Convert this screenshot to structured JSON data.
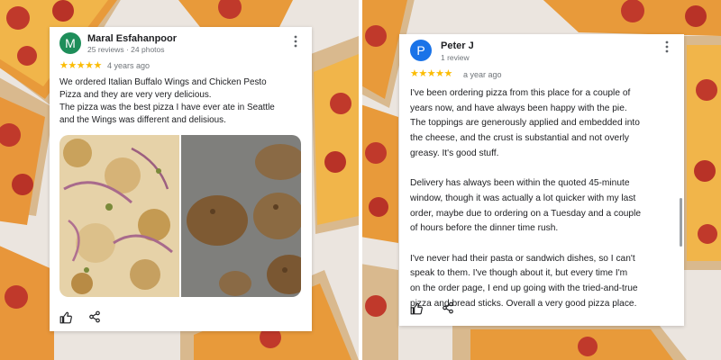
{
  "colors": {
    "star": "#fbbc04",
    "avatar_m": "#1e8e5a",
    "avatar_p": "#1a73e8",
    "text": "#202124",
    "muted": "#70757a"
  },
  "icons": [
    "more-vert-icon",
    "thumbs-up-icon",
    "share-icon"
  ],
  "reviews": [
    {
      "avatar_letter": "M",
      "name": "Maral Esfahanpoor",
      "meta": "25 reviews · 24 photos",
      "rating": 5,
      "stars": "★★★★★",
      "date": "4 years ago",
      "text": "We ordered Italian Buffalo Wings and Chicken Pesto\nPizza and they are very very delicious.\nThe pizza was the best pizza I have ever ate in Seattle\nand the Wings was different and delisious."
    },
    {
      "avatar_letter": "P",
      "name": "Peter J",
      "meta": "1 review",
      "rating": 5,
      "stars": "★★★★★",
      "date": "a year ago",
      "text": "I've been ordering pizza from this place for a couple of\nyears now, and have always been happy with the pie.\nThe toppings are generously applied and embedded into\nthe cheese, and the crust is substantial and not overly\ngreasy. It's good stuff.\n\nDelivery has always been within the quoted 45-minute\nwindow, though it was actually a lot quicker with my last\norder, maybe due to ordering on a Tuesday and a couple\nof hours before the dinner time rush.\n\nI've never had their pasta or sandwich dishes, so I can't\nspeak to them. I've though about it, but every time I'm\non the order page, I end up going with the tried-and-true\npizza and bread sticks. Overall a very good pizza place."
    }
  ]
}
